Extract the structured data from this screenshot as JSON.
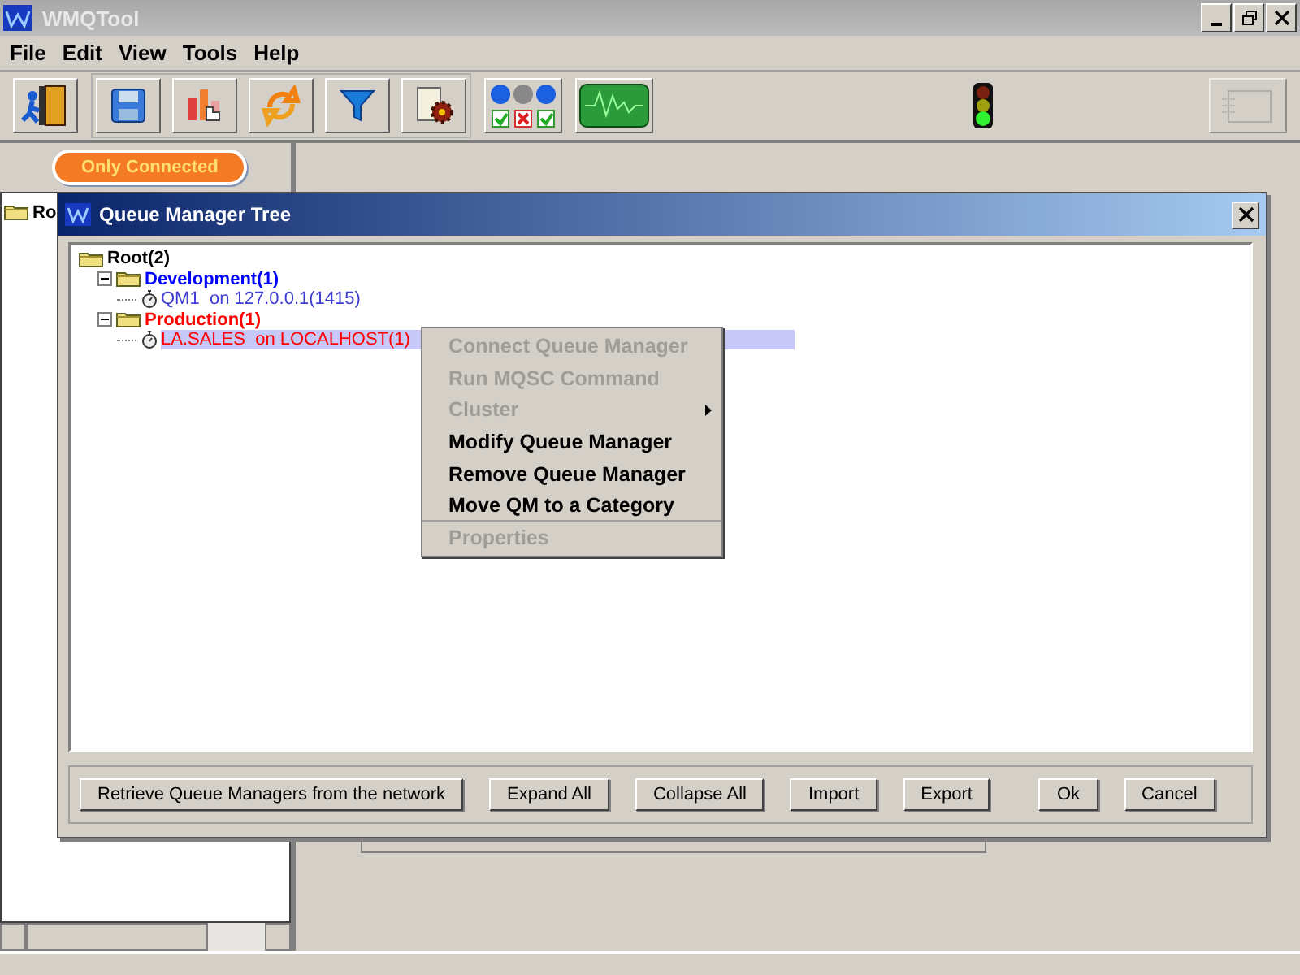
{
  "window": {
    "title": "WMQTool"
  },
  "menu": [
    "File",
    "Edit",
    "View",
    "Tools",
    "Help"
  ],
  "filter_button": {
    "label": "Only Connected"
  },
  "side_tree": {
    "root": "Ro"
  },
  "dialog": {
    "title": "Queue Manager Tree",
    "tree": {
      "label": "Root(2)",
      "children": [
        {
          "label": "Development(1)",
          "kind": "category",
          "color": "#0000ff",
          "expanded": true,
          "children": [
            {
              "label": "QM1  on 127.0.0.1(1415)",
              "kind": "qm",
              "color": "#3c3cd2",
              "selected": false
            }
          ]
        },
        {
          "label": "Production(1)",
          "kind": "category",
          "color": "#ff0000",
          "expanded": true,
          "children": [
            {
              "label": "LA.SALES  on LOCALHOST(1)",
              "kind": "qm",
              "color": "#ff0000",
              "selected": true
            }
          ]
        }
      ]
    },
    "buttons": [
      "Retrieve Queue Managers from the network",
      "Expand All",
      "Collapse All",
      "Import",
      "Export",
      "Ok",
      "Cancel"
    ]
  },
  "context_menu": [
    {
      "label": "Connect Queue Manager",
      "disabled": true,
      "submenu": false
    },
    {
      "label": "Run MQSC Command",
      "disabled": true,
      "submenu": false
    },
    {
      "label": "Cluster",
      "disabled": true,
      "submenu": true
    },
    {
      "label": "Modify Queue Manager",
      "disabled": false,
      "submenu": false
    },
    {
      "label": "Remove Queue Manager",
      "disabled": false,
      "submenu": false
    },
    {
      "label": "Move QM to a Category",
      "disabled": false,
      "submenu": false,
      "separator_after": true
    },
    {
      "label": "Properties",
      "disabled": true,
      "submenu": false
    }
  ]
}
